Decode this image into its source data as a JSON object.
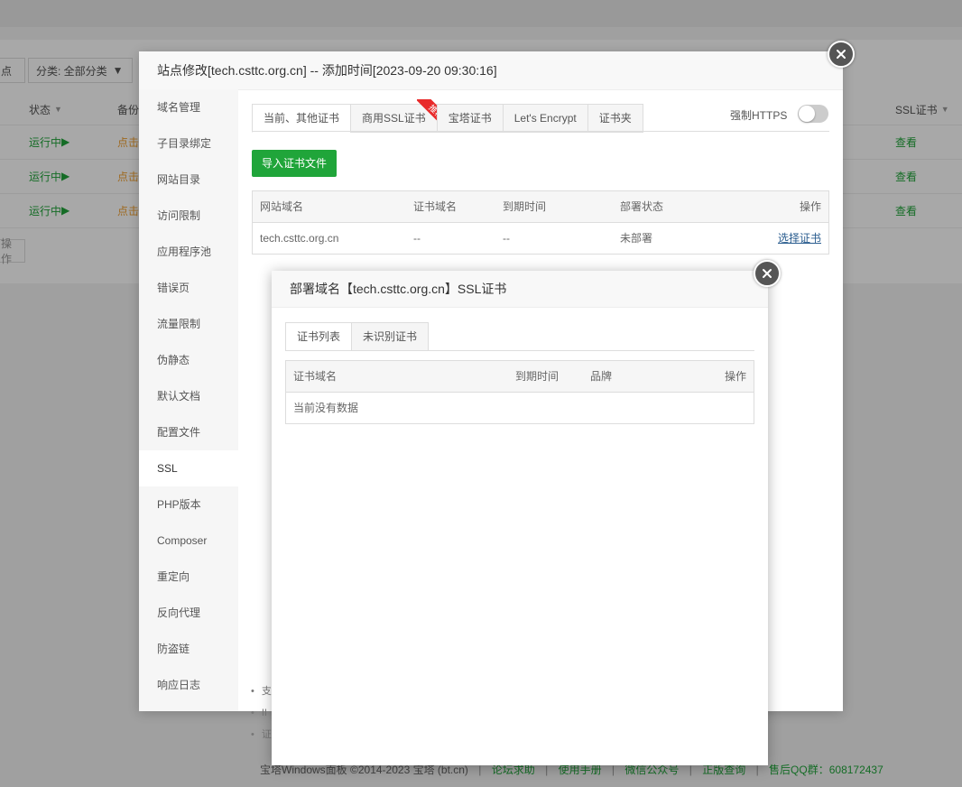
{
  "background": {
    "filter_site_stub": "点",
    "filter_category": "分类: 全部分类",
    "columns": {
      "status": "状态",
      "backup": "备份",
      "ssl": "SSL证书"
    },
    "rows": [
      {
        "status": "运行中",
        "backup": "点击",
        "ssl": "查看"
      },
      {
        "status": "运行中",
        "backup": "点击",
        "ssl": "查看"
      },
      {
        "status": "运行中",
        "backup": "点击",
        "ssl": "查看"
      }
    ],
    "batch_button": "操作",
    "footer": {
      "copyright": "宝塔Windows面板 ©2014-2023 宝塔 (bt.cn)",
      "links": [
        "论坛求助",
        "使用手册",
        "微信公众号",
        "正版查询",
        "售后QQ群：608172437"
      ]
    }
  },
  "site_modal": {
    "title": "站点修改[tech.csttc.org.cn] -- 添加时间[2023-09-20 09:30:16]",
    "menu": [
      "域名管理",
      "子目录绑定",
      "网站目录",
      "访问限制",
      "应用程序池",
      "错误页",
      "流量限制",
      "伪静态",
      "默认文档",
      "配置文件",
      "SSL",
      "PHP版本",
      "Composer",
      "重定向",
      "反向代理",
      "防盗链",
      "响应日志"
    ],
    "active_menu": "SSL",
    "tabs": [
      "当前、其他证书",
      "商用SSL证书",
      "宝塔证书",
      "Let's Encrypt",
      "证书夹"
    ],
    "ribbon": "推荐",
    "force_https_label": "强制HTTPS",
    "force_https_on": false,
    "import_button": "导入证书文件",
    "table": {
      "headers": [
        "网站域名",
        "证书域名",
        "到期时间",
        "部署状态",
        "操作"
      ],
      "rows": [
        {
          "domain": "tech.csttc.org.cn",
          "cert_domain": "--",
          "expire": "--",
          "status": "未部署",
          "action": "选择证书"
        }
      ]
    },
    "tips": [
      "支",
      "II",
      "证"
    ]
  },
  "ssl_modal": {
    "title": "部署域名【tech.csttc.org.cn】SSL证书",
    "tabs": [
      "证书列表",
      "未识别证书"
    ],
    "table": {
      "headers": [
        "证书域名",
        "到期时间",
        "品牌",
        "操作"
      ],
      "empty": "当前没有数据"
    }
  },
  "colors": {
    "accent_green": "#20a53a",
    "link_blue": "#2a5d8f",
    "ribbon_red": "#e82a2a"
  }
}
